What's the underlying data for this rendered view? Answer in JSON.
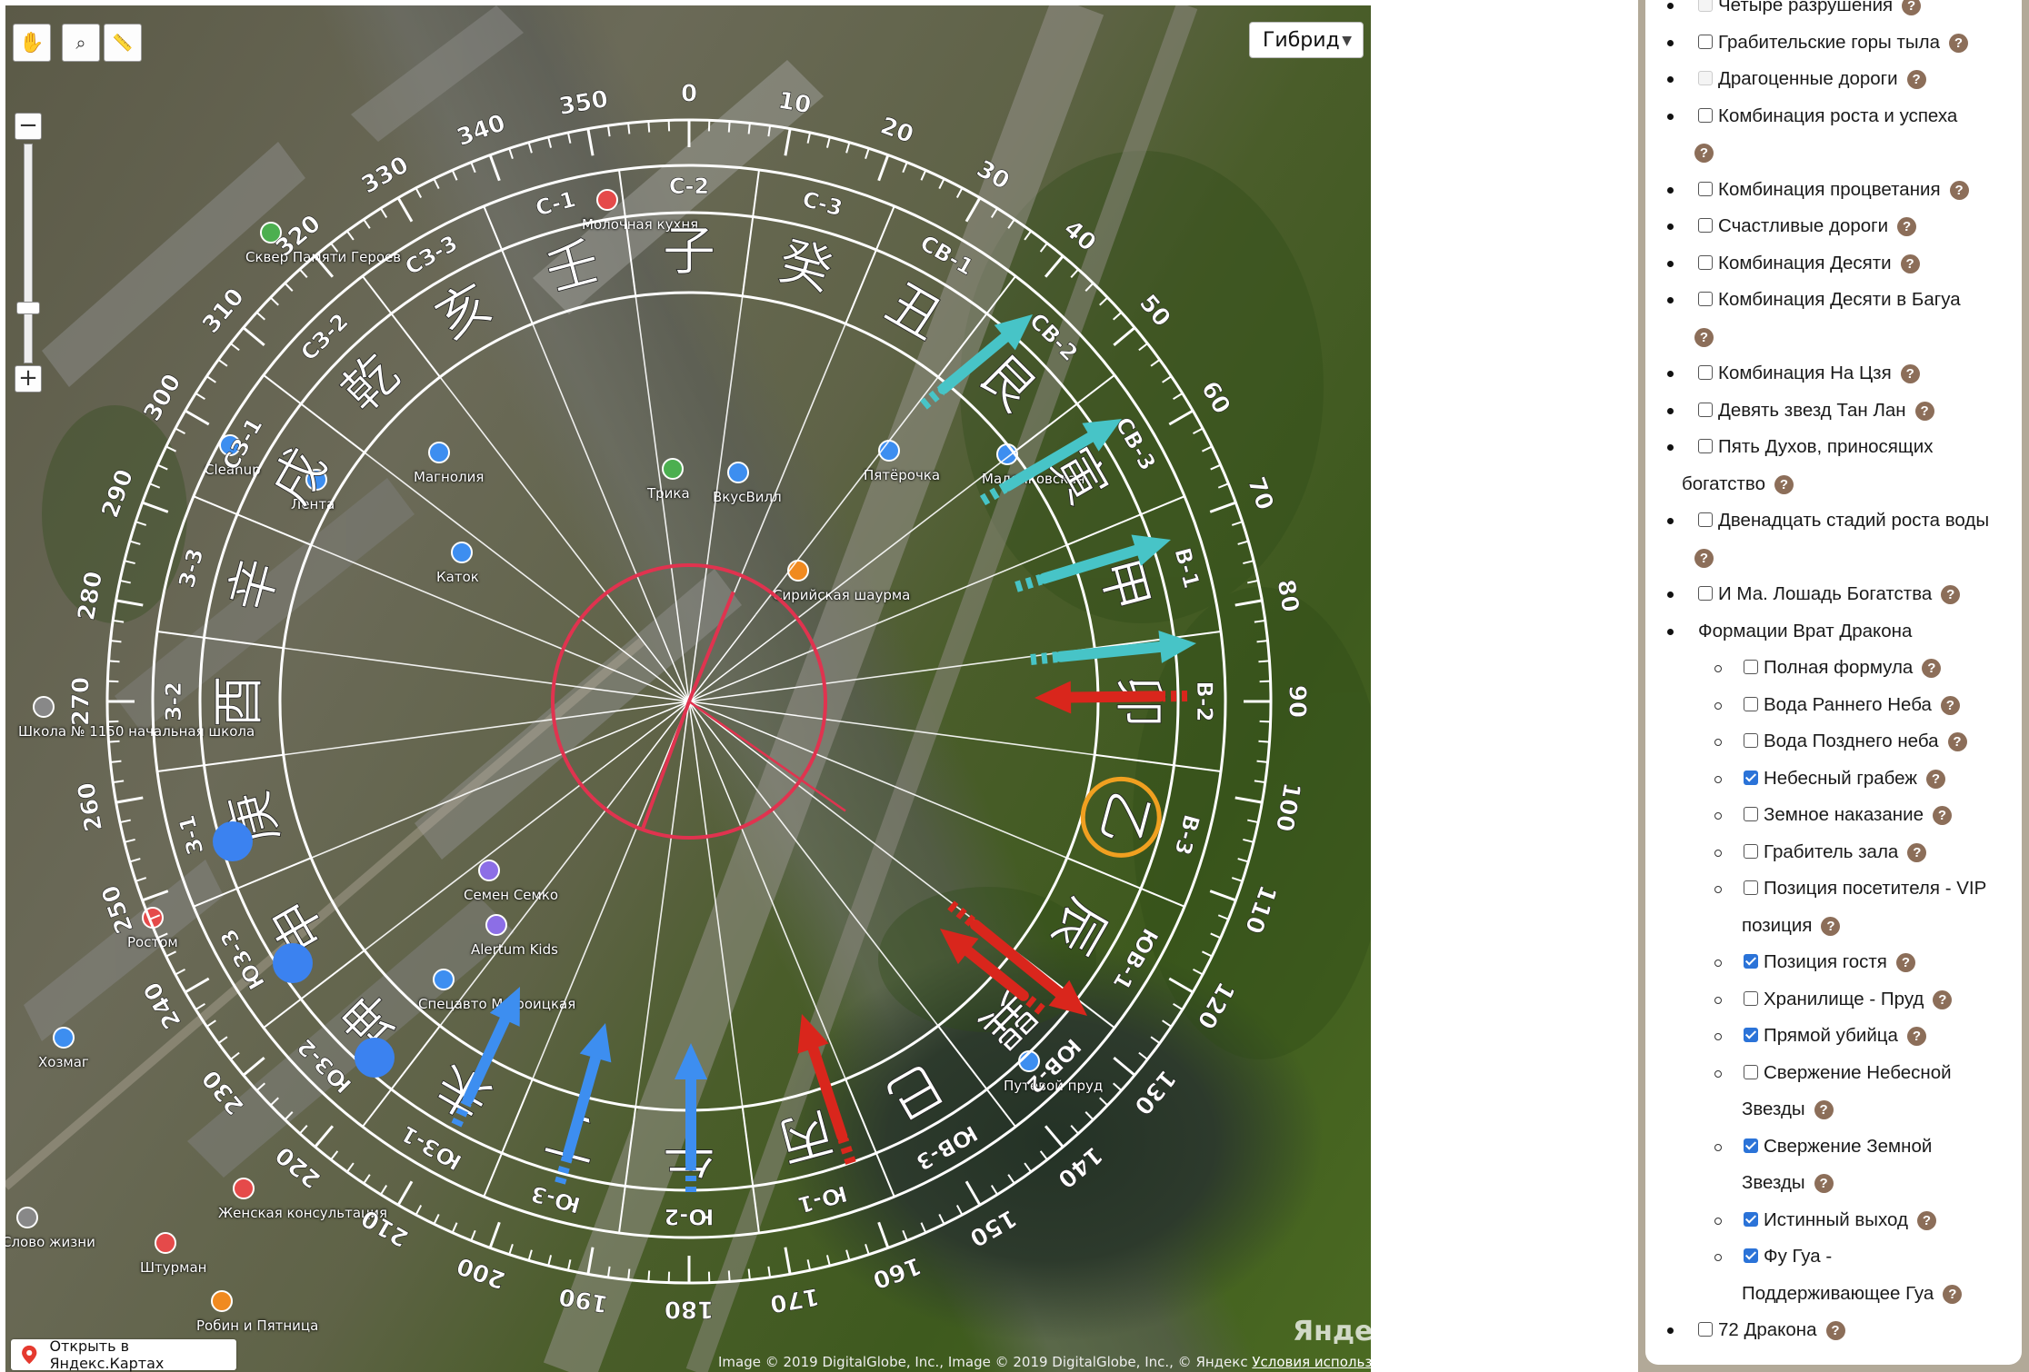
{
  "map": {
    "layer_button": "Гибрид",
    "open_in_maps": "Открыть в Яндекс.Картах",
    "copyright": "Image © 2019 DigitalGlobe, Inc., Image © 2019 DigitalGlobe, Inc., © Яндекс",
    "terms_link": "Условия использования",
    "logo": "Яндекс",
    "tools": [
      "hand-icon",
      "magnifier-icon",
      "ruler-icon"
    ],
    "zoom_in": "+",
    "zoom_out": "−",
    "poi": [
      {
        "label": "Молочная кухня"
      },
      {
        "label": "Сквер Памяти Героев"
      },
      {
        "label": "Магнолия"
      },
      {
        "label": "Cleanup"
      },
      {
        "label": "Лента"
      },
      {
        "label": "Трика"
      },
      {
        "label": "ВкусВилл"
      },
      {
        "label": "Пятёрочка"
      },
      {
        "label": "Каток"
      },
      {
        "label": "Сирийская шаурма"
      },
      {
        "label": "Семен Семко"
      },
      {
        "label": "Alertum Kids"
      },
      {
        "label": "Спецавто М Троицкая"
      },
      {
        "label": "Ростом"
      },
      {
        "label": "Хозмаг"
      },
      {
        "label": "Женская консультация"
      },
      {
        "label": "Слово жизни"
      },
      {
        "label": "Штурман"
      },
      {
        "label": "Робин и Пятница"
      },
      {
        "label": "Школа № 1150 начальная школа"
      },
      {
        "label": "Путевой пруд"
      },
      {
        "label": "Маленковская"
      }
    ]
  },
  "compass": {
    "degree_labels": [
      "0",
      "10",
      "20",
      "30",
      "40",
      "50",
      "60",
      "70",
      "80",
      "90",
      "100",
      "110",
      "120",
      "130",
      "140",
      "150",
      "160",
      "170",
      "180",
      "190",
      "200",
      "210",
      "220",
      "230",
      "240",
      "250",
      "260",
      "270",
      "280",
      "290",
      "300",
      "310",
      "320",
      "330",
      "340",
      "350"
    ],
    "sectors": [
      {
        "code": "С-1",
        "char": "壬"
      },
      {
        "code": "С-2",
        "char": "子"
      },
      {
        "code": "С-3",
        "char": "癸"
      },
      {
        "code": "СВ-1",
        "char": "丑"
      },
      {
        "code": "СВ-2",
        "char": "艮"
      },
      {
        "code": "СВ-3",
        "char": "寅"
      },
      {
        "code": "В-1",
        "char": "甲"
      },
      {
        "code": "В-2",
        "char": "卯"
      },
      {
        "code": "В-3",
        "char": "乙"
      },
      {
        "code": "ЮВ-1",
        "char": "辰"
      },
      {
        "code": "ЮВ-2",
        "char": "巽"
      },
      {
        "code": "ЮВ-3",
        "char": "巳"
      },
      {
        "code": "Ю-1",
        "char": "丙"
      },
      {
        "code": "Ю-2",
        "char": "午"
      },
      {
        "code": "Ю-3",
        "char": "丁"
      },
      {
        "code": "ЮЗ-1",
        "char": "未"
      },
      {
        "code": "ЮЗ-2",
        "char": "坤"
      },
      {
        "code": "ЮЗ-3",
        "char": "申"
      },
      {
        "code": "З-1",
        "char": "庚"
      },
      {
        "code": "З-2",
        "char": "酉"
      },
      {
        "code": "З-3",
        "char": "辛"
      },
      {
        "code": "СЗ-1",
        "char": "戌"
      },
      {
        "code": "СЗ-2",
        "char": "乾"
      },
      {
        "code": "СЗ-3",
        "char": "亥"
      }
    ],
    "highlighted_sector": "В-3",
    "colors": {
      "ring": "#ffffff",
      "center_circle": "#e0334f",
      "teal_arrow": "#47c4c7",
      "red_arrow": "#d9261c",
      "blue_arrow": "#3d8ef0",
      "blue_dot": "#3b82f0",
      "highlight": "#f0a020"
    }
  },
  "panel": {
    "items": [
      {
        "label": "Четыре разрушения",
        "checked": false,
        "disabled": true,
        "level": 1
      },
      {
        "label": "Грабительские горы тыла",
        "checked": false,
        "level": 1
      },
      {
        "label": "Драгоценные дороги",
        "checked": false,
        "disabled": true,
        "level": 1
      },
      {
        "label": "Комбинация роста и успеха",
        "checked": false,
        "level": 1,
        "help_wraps": true
      },
      {
        "label": "Комбинация процветания",
        "checked": false,
        "level": 1
      },
      {
        "label": "Счастливые дороги",
        "checked": false,
        "level": 1
      },
      {
        "label": "Комбинация Десяти",
        "checked": false,
        "level": 1
      },
      {
        "label": "Комбинация Десяти в Багуа",
        "checked": false,
        "level": 1,
        "help_wraps": true
      },
      {
        "label": "Комбинация На Цзя",
        "checked": false,
        "level": 1
      },
      {
        "label": "Девять звезд Тан Лан",
        "checked": false,
        "level": 1
      },
      {
        "label": "Пять Духов, приносящих",
        "label2": "богатство",
        "checked": false,
        "level": 1
      },
      {
        "label": "Двенадцать стадий роста воды",
        "checked": false,
        "level": 1,
        "help_wraps": true
      },
      {
        "label": "И Ма. Лошадь Богатства",
        "checked": false,
        "level": 1
      },
      {
        "label": "Формации Врат Дракона",
        "group": true,
        "level": 1
      },
      {
        "label": "Полная формула",
        "checked": false,
        "level": 2
      },
      {
        "label": "Вода Раннего Неба",
        "checked": false,
        "level": 2
      },
      {
        "label": "Вода Позднего неба",
        "checked": false,
        "level": 2
      },
      {
        "label": "Небесный грабеж",
        "checked": true,
        "level": 2
      },
      {
        "label": "Земное наказание",
        "checked": false,
        "level": 2
      },
      {
        "label": "Грабитель зала",
        "checked": false,
        "level": 2
      },
      {
        "label": "Позиция посетителя - VIP",
        "label2": "позиция",
        "checked": false,
        "level": 2
      },
      {
        "label": "Позиция гостя",
        "checked": true,
        "level": 2
      },
      {
        "label": "Хранилище - Пруд",
        "checked": false,
        "level": 2
      },
      {
        "label": "Прямой убийца",
        "checked": true,
        "level": 2
      },
      {
        "label": "Свержение Небесной",
        "label2": "Звезды",
        "checked": false,
        "level": 2
      },
      {
        "label": "Свержение Земной",
        "label2": "Звезды",
        "checked": true,
        "level": 2
      },
      {
        "label": "Истинный выход",
        "checked": true,
        "level": 2
      },
      {
        "label": "Фу Гуа -",
        "label2": "Поддерживающее Гуа",
        "checked": true,
        "level": 2
      },
      {
        "label": "72 Дракона",
        "checked": false,
        "level": 1
      }
    ],
    "help_label": "?"
  }
}
